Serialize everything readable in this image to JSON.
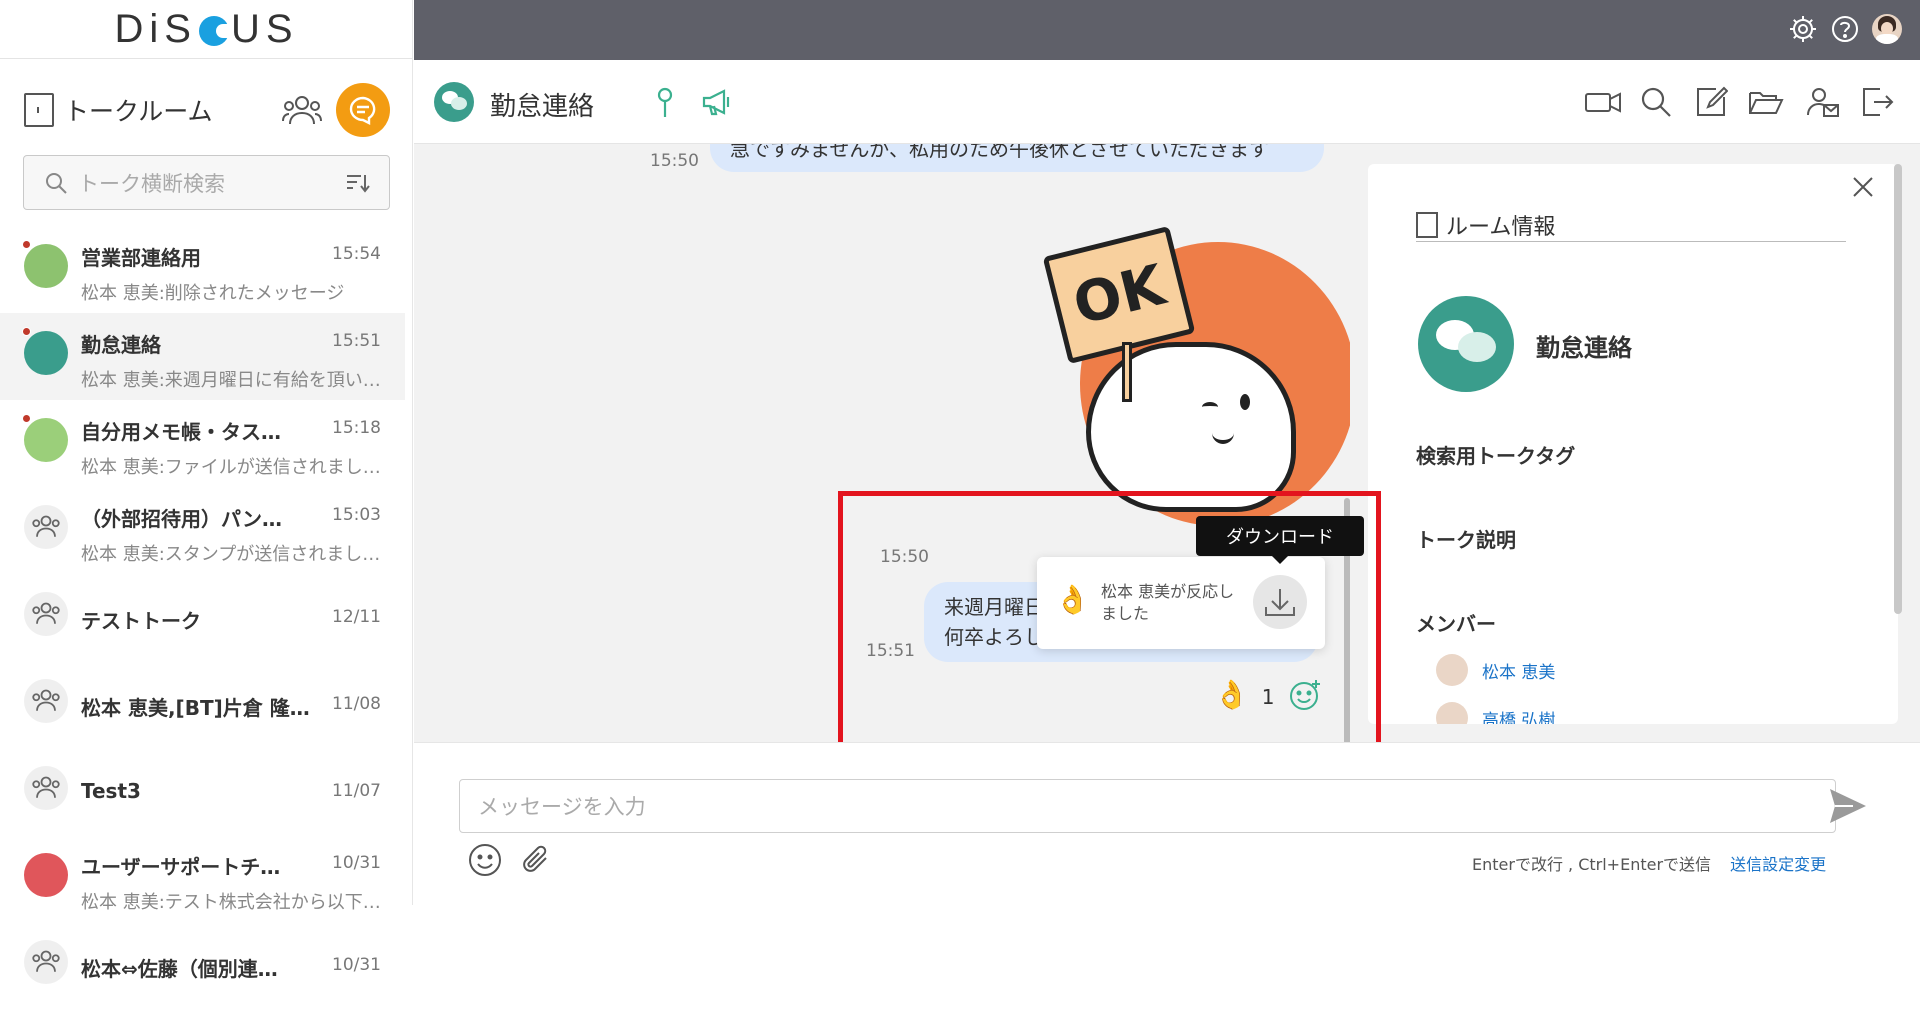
{
  "app": {
    "logo_text": "DiSCUS"
  },
  "sidebar": {
    "title": "トークルーム",
    "search_placeholder": "トーク横断検索",
    "rooms": [
      {
        "name": "営業部連絡用",
        "time": "15:54",
        "last": "松本 恵美:削除されたメッセージ",
        "unread": true
      },
      {
        "name": "勤怠連絡",
        "time": "15:51",
        "last": "松本 恵美:来週月曜日に有給を頂い…",
        "unread": true,
        "active": true
      },
      {
        "name": "自分用メモ帳・タス…",
        "time": "15:18",
        "last": "松本 恵美:ファイルが送信されまし…",
        "unread": true
      },
      {
        "name": "（外部招待用）パン…",
        "time": "15:03",
        "last": "松本 恵美:スタンプが送信されまし…"
      },
      {
        "name": "テストトーク",
        "time": "12/11",
        "last": ""
      },
      {
        "name": "松本 恵美,[BT]片倉 隆…",
        "time": "11/08",
        "last": ""
      },
      {
        "name": "Test3",
        "time": "11/07",
        "last": ""
      },
      {
        "name": "ユーザーサポートチ…",
        "time": "10/31",
        "last": "松本 恵美:テスト株式会社から以下…"
      },
      {
        "name": "松本⇔佐藤（個別連…",
        "time": "10/31",
        "last": ""
      }
    ]
  },
  "chat": {
    "room_title": "勤怠連絡",
    "messages": {
      "top_partial_text": "急ですみませんが、私用のため午後休とさせていただきます",
      "top_partial_time": "15:50",
      "sticker_time": "15:50",
      "msg_line1": "来週月曜日",
      "msg_line2": "何卒よろし",
      "msg_time": "15:51",
      "reaction_emoji": "👌",
      "reaction_count": "1"
    },
    "tooltip": "ダウンロード",
    "popup_text": "松本 恵美が反応しました",
    "popup_emoji": "👌",
    "composer_placeholder": "メッセージを入力",
    "send_hint": "Enterで改行 , Ctrl+Enterで送信",
    "send_setting_link": "送信設定変更"
  },
  "panel": {
    "title": "ルーム情報",
    "room_name": "勤怠連絡",
    "tag_label": "検索用トークタグ",
    "desc_label": "トーク説明",
    "members_label": "メンバー",
    "members": [
      "松本 恵美",
      "高橋 弘樹"
    ]
  },
  "colors": {
    "accent_orange": "#f39c12",
    "topbar": "#5f6069",
    "bubble": "#dbe8fb",
    "teal": "#3a9d8c",
    "highlight_red": "#e3141e",
    "link_blue": "#1a73c8"
  }
}
